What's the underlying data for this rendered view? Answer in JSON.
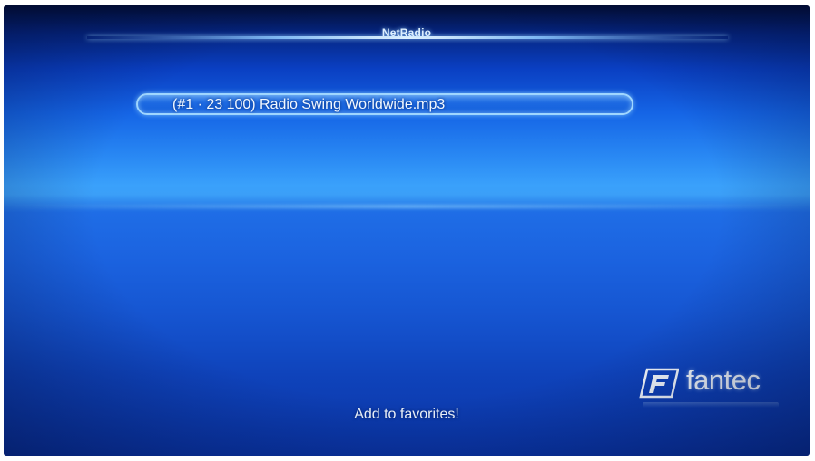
{
  "header": {
    "title": "NetRadio"
  },
  "playlist": {
    "items": [
      {
        "label": "(#1 · 23 100) Radio Swing Worldwide.mp3",
        "selected": true
      }
    ]
  },
  "brand": {
    "logo_text": "fantec",
    "logo_icon": "fantec-f-logo"
  },
  "status": {
    "message": "Add to favorites!"
  },
  "colors": {
    "background": "#1b63e0",
    "highlight_border": "#9fd6ff",
    "text": "#f2f8ff"
  }
}
